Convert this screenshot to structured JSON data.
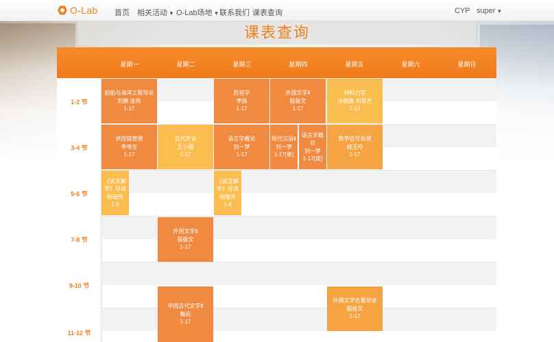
{
  "nav": {
    "brand": "O-Lab",
    "items": [
      {
        "label": "首页"
      },
      {
        "label": "相关活动",
        "dropdown": true
      },
      {
        "label": "O-Lab场地",
        "dropdown": true
      },
      {
        "label": "联系我们"
      },
      {
        "label": "课表查询"
      }
    ],
    "user_org": "CYP",
    "user_name": "super"
  },
  "page_title": "课表查询",
  "days": [
    "星期一",
    "星期二",
    "星期三",
    "星期四",
    "星期五",
    "星期六",
    "星期日"
  ],
  "periods": [
    "1-2 节",
    "3-4 节",
    "5-6 节",
    "7-8 节",
    "9-10 节",
    "11-12 节"
  ],
  "courses": [
    {
      "name": "船舶与海洋工程导论",
      "teacher": "刘鹏 庞亮",
      "weeks": "1-17"
    },
    {
      "name": "民俗学",
      "teacher": "李扬",
      "weeks": "1-17"
    },
    {
      "name": "外国文学Ⅱ",
      "teacher": "殷振文",
      "weeks": "1-17"
    },
    {
      "name": "材料力学",
      "teacher": "冷颜鑫 刘恩杰",
      "weeks": "1-17"
    },
    {
      "name": "供应链管理",
      "teacher": "李电生",
      "weeks": "1-17"
    },
    {
      "name": "古代文论",
      "teacher": "王小丽",
      "weeks": "1-17"
    },
    {
      "name": "语言学概论",
      "teacher": "刘一梦",
      "weeks": "1-17"
    },
    {
      "name": "现代汉语Ⅱ",
      "teacher": "刘一梦",
      "weeks": "1-17[单]"
    },
    {
      "name": "语言学概论",
      "teacher": "刘一梦",
      "weeks": "1-17[双]"
    },
    {
      "name": "数字信号处理",
      "teacher": "姚玉玲",
      "weeks": "1-17"
    },
    {
      "name": "《说文解字》导读",
      "teacher": "杨瑞芳",
      "weeks": "1-8"
    },
    {
      "name": "《说文解字》导读",
      "teacher": "杨瑞芳",
      "weeks": "1-8"
    },
    {
      "name": "外国文学Ⅱ",
      "teacher": "殷振文",
      "weeks": "1-17"
    },
    {
      "name": "中国古代文学Ⅱ",
      "teacher": "鞠岩",
      "weeks": "1-17"
    },
    {
      "name": "外国文学名著导读",
      "teacher": "殷振文",
      "weeks": "1-17"
    }
  ],
  "colors": {
    "brand": "#f07f1d",
    "course_dark": "#f08a41",
    "course_mid": "#f5a343",
    "course_light": "#fbbd4f"
  }
}
